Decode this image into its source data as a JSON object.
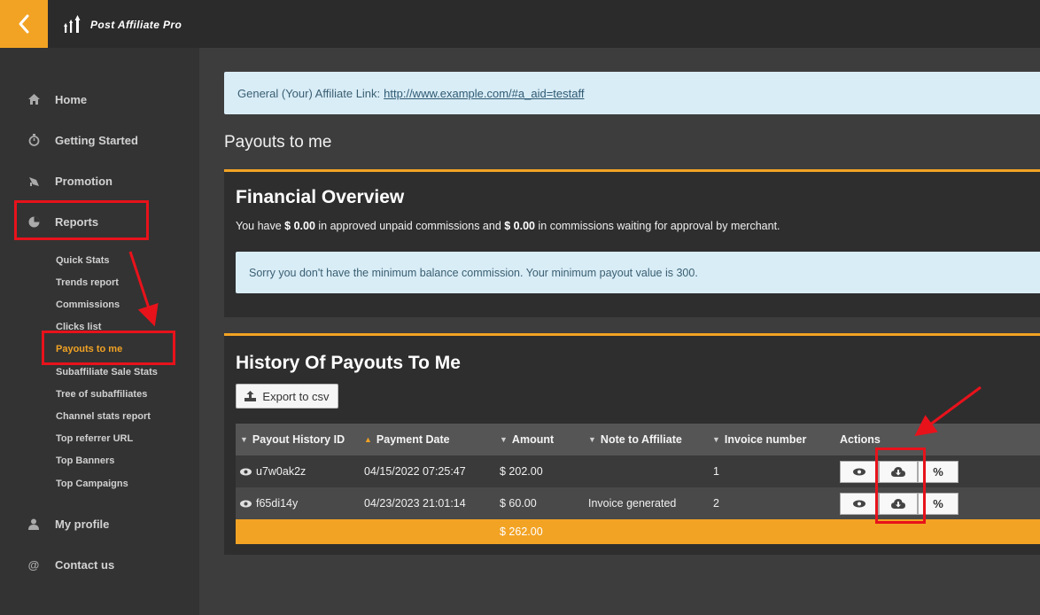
{
  "header": {
    "app_name": "Post Affiliate Pro"
  },
  "sidebar": {
    "items": [
      {
        "label": "Home"
      },
      {
        "label": "Getting Started"
      },
      {
        "label": "Promotion"
      },
      {
        "label": "Reports"
      },
      {
        "label": "My profile"
      },
      {
        "label": "Contact us"
      }
    ],
    "reports_submenu": [
      "Quick Stats",
      "Trends report",
      "Commissions",
      "Clicks list",
      "Payouts to me",
      "Subaffiliate Sale Stats",
      "Tree of subaffiliates",
      "Channel stats report",
      "Top referrer URL",
      "Top Banners",
      "Top Campaigns"
    ]
  },
  "affiliate_link": {
    "label": "General (Your) Affiliate Link:",
    "url": "http://www.example.com/#a_aid=testaff"
  },
  "page_title": "Payouts to me",
  "financial_overview": {
    "title": "Financial Overview",
    "text_1": "You have ",
    "approved_amount": "$ 0.00",
    "text_2": " in approved unpaid commissions and ",
    "waiting_amount": "$ 0.00",
    "text_3": " in commissions waiting for approval by merchant.",
    "notice": "Sorry you don't have the minimum balance commission. Your minimum payout value is 300."
  },
  "history": {
    "title": "History Of Payouts To Me",
    "export_label": "Export to csv",
    "columns": [
      "Payout History ID",
      "Payment Date",
      "Amount",
      "Note to Affiliate",
      "Invoice number",
      "Actions"
    ],
    "sorted_column": "Payment Date",
    "rows": [
      {
        "id": "u7w0ak2z",
        "date": "04/15/2022 07:25:47",
        "amount": "$ 202.00",
        "note": "",
        "invoice": "1"
      },
      {
        "id": "f65di14y",
        "date": "04/23/2023 21:01:14",
        "amount": "$ 60.00",
        "note": "Invoice generated",
        "invoice": "2"
      }
    ],
    "total": "$ 262.00",
    "percent_label": "%"
  },
  "colors": {
    "accent": "#f2a324",
    "highlight": "#e8121b",
    "info_bg": "#d9edf7"
  }
}
